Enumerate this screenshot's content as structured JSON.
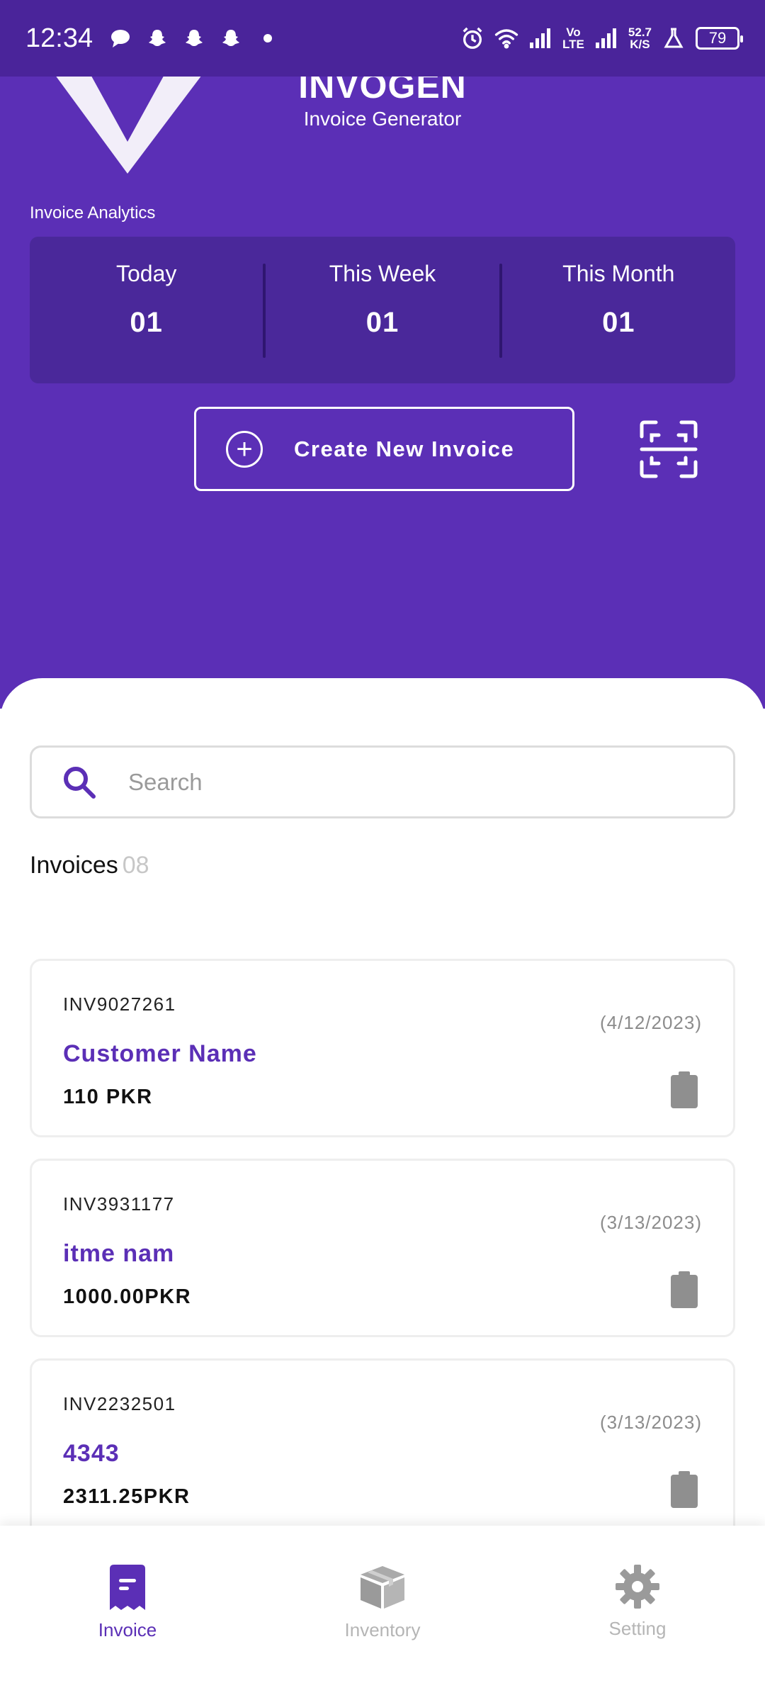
{
  "statusbar": {
    "time": "12:34",
    "net_speed_value": "52.7",
    "net_speed_unit": "K/S",
    "battery": "79",
    "network_label_top": "Vo",
    "network_label_bottom": "LTE"
  },
  "brand": {
    "name": "INVOGEN",
    "subtitle": "Invoice Generator",
    "color": "#5b2fb6"
  },
  "analytics": {
    "title": "Invoice Analytics",
    "items": [
      {
        "label": "Today",
        "value": "01"
      },
      {
        "label": "This Week",
        "value": "01"
      },
      {
        "label": "This Month",
        "value": "01"
      }
    ]
  },
  "actions": {
    "create_label": "Create New Invoice"
  },
  "search": {
    "placeholder": "Search"
  },
  "invoices": {
    "heading": "Invoices",
    "count": "08",
    "items": [
      {
        "id": "INV9027261",
        "date": "(4/12/2023)",
        "customer": "Customer Name",
        "amount": "110 PKR"
      },
      {
        "id": "INV3931177",
        "date": "(3/13/2023)",
        "customer": "itme nam",
        "amount": "1000.00PKR"
      },
      {
        "id": "INV2232501",
        "date": "(3/13/2023)",
        "customer": "4343",
        "amount": "2311.25PKR"
      }
    ]
  },
  "nav": {
    "items": [
      {
        "label": "Invoice",
        "icon": "invoice-icon",
        "active": true
      },
      {
        "label": "Inventory",
        "icon": "box-icon",
        "active": false
      },
      {
        "label": "Setting",
        "icon": "gear-icon",
        "active": false
      }
    ]
  }
}
